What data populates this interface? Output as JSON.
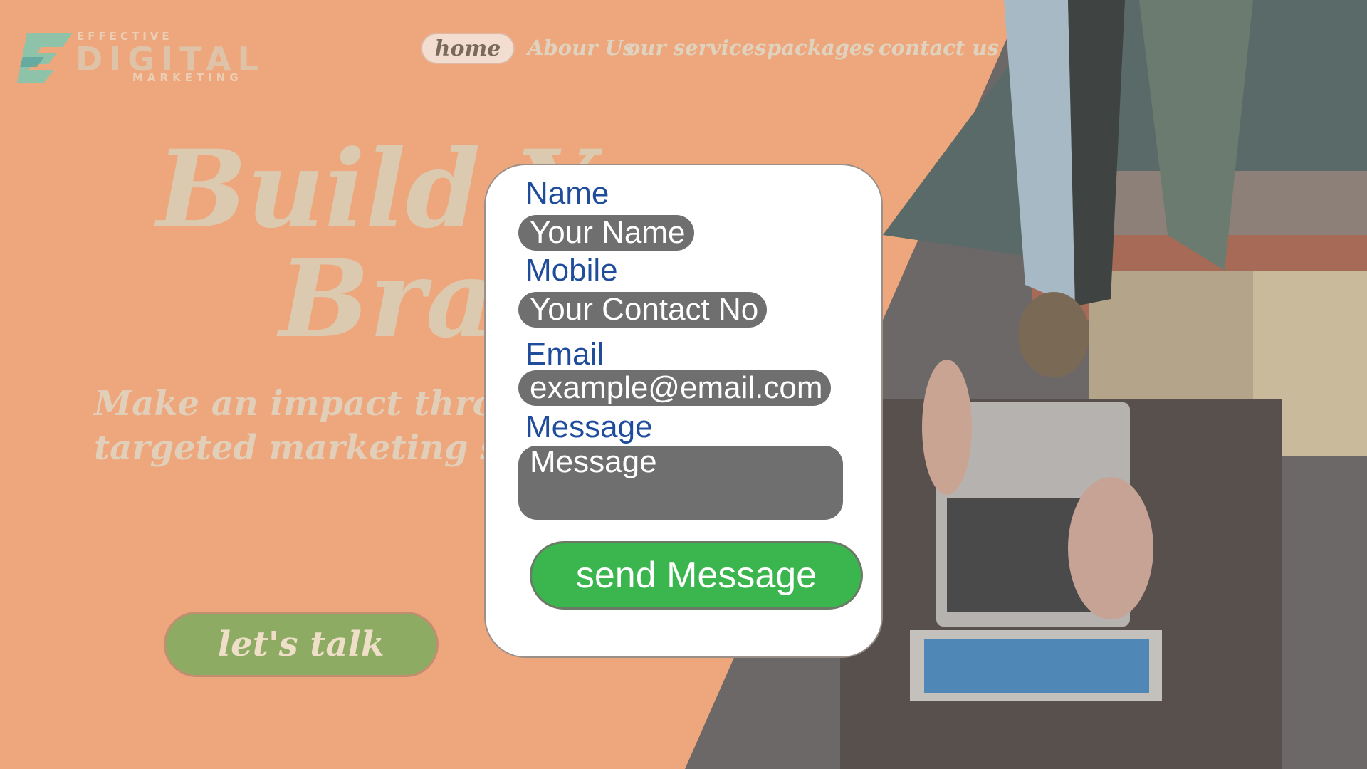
{
  "logo": {
    "top_text": "EFFECTIVE",
    "main_text": "DIGITAL",
    "sub_text": "MARKETING"
  },
  "nav": {
    "items": [
      "home",
      "Abour Us",
      "our services",
      "packages",
      "contact us"
    ],
    "active_index": 0
  },
  "hero": {
    "line1": "Build Your",
    "line2": "Brand",
    "tagline_line1": "Make an impact through",
    "tagline_line2": "targeted marketing solutions",
    "cta_label": "let's talk"
  },
  "form": {
    "name_label": "Name",
    "name_placeholder": "Your Name",
    "mobile_label": "Mobile",
    "mobile_placeholder": "Your Contact No",
    "email_label": "Email",
    "email_placeholder": "example@email.com",
    "message_label": "Message",
    "message_placeholder": "Message",
    "submit_label": "send Message"
  },
  "colors": {
    "background": "#eea77c",
    "submit_button": "#3bb54d",
    "form_label": "#1f4d9c",
    "input_fill": "#6f6f6f",
    "cta_button": "#8dab63"
  }
}
